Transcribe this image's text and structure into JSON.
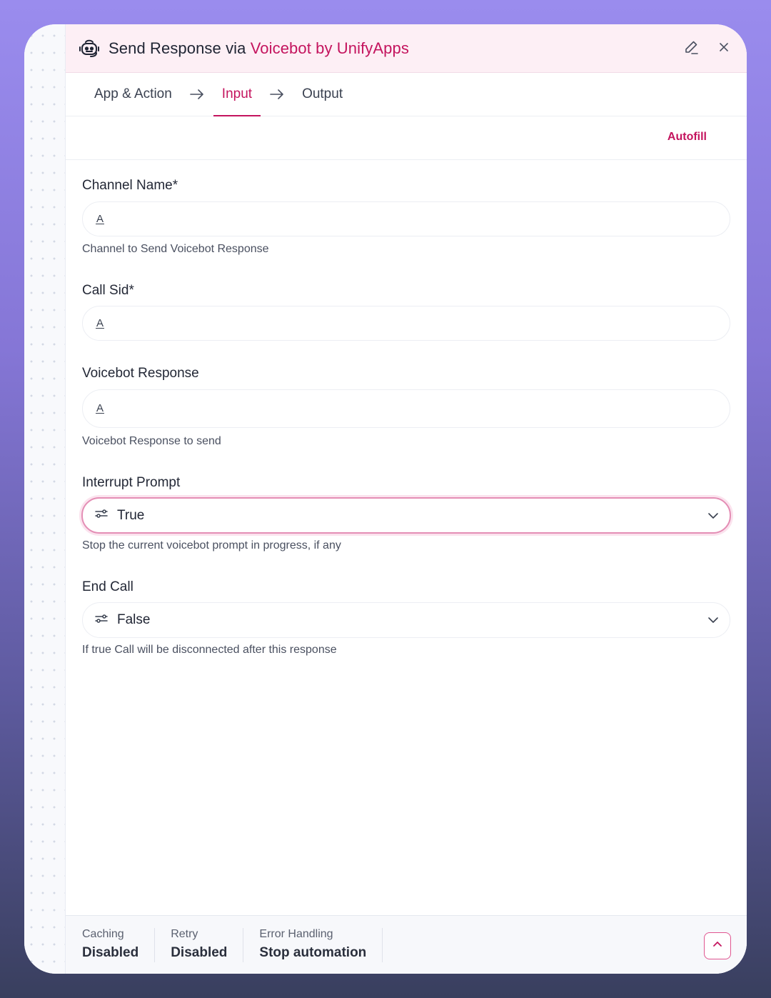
{
  "header": {
    "title_prefix": "Send Response via ",
    "title_brand": "Voicebot by UnifyApps",
    "icons": [
      "bot-icon",
      "edit-icon",
      "close-icon"
    ]
  },
  "tabs": [
    {
      "label": "App & Action",
      "active": false
    },
    {
      "label": "Input",
      "active": true
    },
    {
      "label": "Output",
      "active": false
    }
  ],
  "autofill_label": "Autofill",
  "fields": {
    "channel_name": {
      "label": "Channel Name*",
      "hint": "Channel to Send Voicebot Response",
      "type_icon": "A"
    },
    "call_sid": {
      "label": "Call Sid*",
      "type_icon": "A"
    },
    "voicebot_response": {
      "label": "Voicebot Response",
      "hint": "Voicebot Response to send",
      "type_icon": "A"
    },
    "interrupt_prompt": {
      "label": "Interrupt Prompt",
      "value": "True",
      "hint": "Stop the current voicebot prompt in progress, if any"
    },
    "end_call": {
      "label": "End Call",
      "value": "False",
      "hint": "If true Call will be disconnected after this response"
    }
  },
  "footer": {
    "caching": {
      "label": "Caching",
      "value": "Disabled"
    },
    "retry": {
      "label": "Retry",
      "value": "Disabled"
    },
    "error_handling": {
      "label": "Error Handling",
      "value": "Stop automation"
    }
  },
  "colors": {
    "accent": "#c4145e",
    "header_bg": "#fdeff5"
  }
}
